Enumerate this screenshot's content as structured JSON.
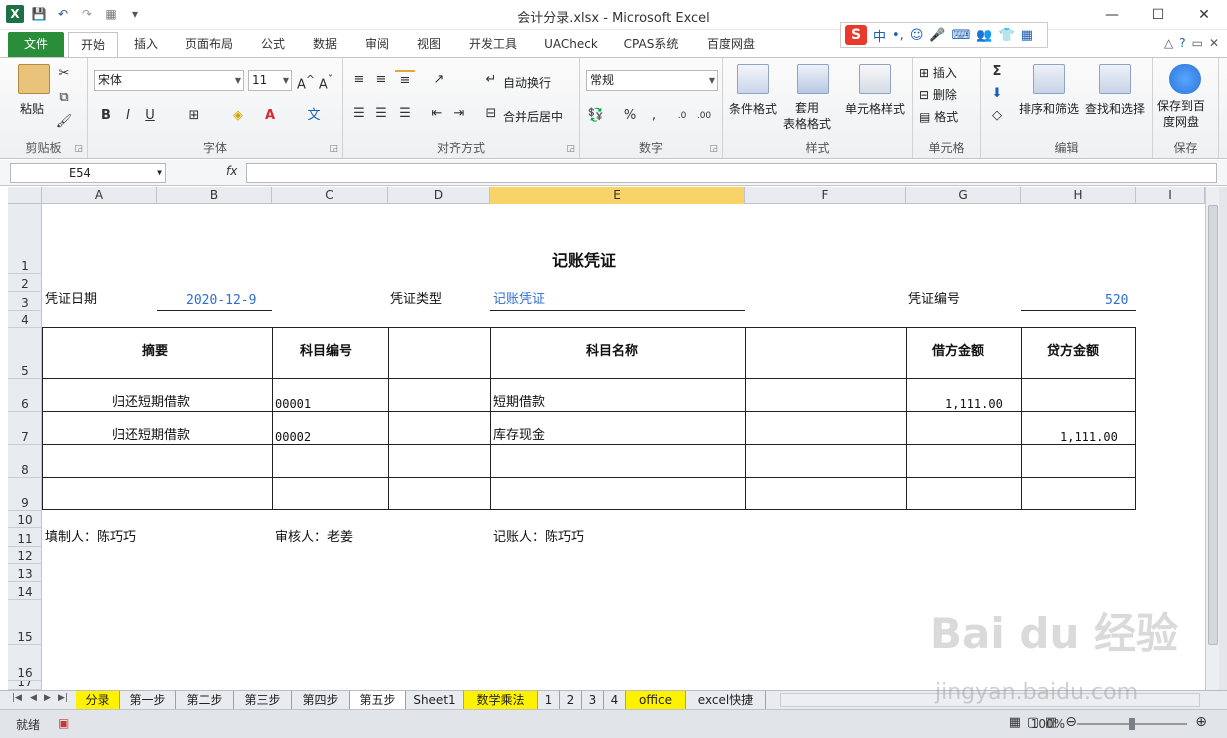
{
  "window": {
    "title": "会计分录.xlsx - Microsoft Excel",
    "minimize": "—",
    "maximize": "☐",
    "close": "✕"
  },
  "ime": {
    "logo": "S",
    "lang": "中",
    "punct": "•,"
  },
  "ribbon_tabs": [
    "文件",
    "开始",
    "插入",
    "页面布局",
    "公式",
    "数据",
    "审阅",
    "视图",
    "开发工具",
    "UACheck",
    "CPAS系统",
    "百度网盘"
  ],
  "ribbon": {
    "clipboard": {
      "label": "剪贴板",
      "paste": "粘贴"
    },
    "font": {
      "label": "字体",
      "name": "宋体",
      "size": "11",
      "bold": "B",
      "italic": "I",
      "underline": "U"
    },
    "align": {
      "label": "对齐方式",
      "wrap": "自动换行",
      "merge": "合并后居中"
    },
    "number": {
      "label": "数字",
      "format": "常规",
      "percent": "%",
      "comma": ","
    },
    "styles": {
      "label": "样式",
      "conditional": "条件格式",
      "table": "套用\n表格格式",
      "cell": "单元格样式"
    },
    "cells": {
      "label": "单元格",
      "insert": "插入",
      "delete": "删除",
      "format": "格式"
    },
    "editing": {
      "label": "编辑",
      "sum": "Σ",
      "sort": "排序和筛选",
      "find": "查找和选择"
    },
    "save": {
      "label": "保存",
      "save_to": "保存到百\n度网盘"
    }
  },
  "formula_bar": {
    "name_box": "E54",
    "fx": "fx",
    "value": ""
  },
  "columns": [
    "A",
    "B",
    "C",
    "D",
    "E",
    "F",
    "G",
    "H",
    "I"
  ],
  "rows": [
    "1",
    "2",
    "3",
    "4",
    "5",
    "6",
    "7",
    "8",
    "9",
    "10",
    "11",
    "12",
    "13",
    "14",
    "15",
    "16",
    "17"
  ],
  "sheet": {
    "title": "记账凭证",
    "date_label": "凭证日期",
    "date_value": "2020-12-9",
    "type_label": "凭证类型",
    "type_value": "记账凭证",
    "no_label": "凭证编号",
    "no_value": "520",
    "headers": {
      "summary": "摘要",
      "code": "科目编号",
      "name": "科目名称",
      "debit": "借方金额",
      "credit": "贷方金额"
    },
    "entries": [
      {
        "summary": "归还短期借款",
        "code": "00001",
        "name": "短期借款",
        "debit": "1,111.00",
        "credit": ""
      },
      {
        "summary": "归还短期借款",
        "code": "00002",
        "name": "库存现金",
        "debit": "",
        "credit": "1,111.00"
      }
    ],
    "preparer": "填制人：陈巧巧",
    "reviewer": "审核人：老姜",
    "bookkeeper": "记账人：陈巧巧"
  },
  "sheet_tabs": [
    {
      "name": "分录",
      "yellow": true
    },
    {
      "name": "第一步",
      "yellow": false
    },
    {
      "name": "第二步",
      "yellow": false
    },
    {
      "name": "第三步",
      "yellow": false
    },
    {
      "name": "第四步",
      "yellow": false
    },
    {
      "name": "第五步",
      "yellow": false,
      "active": true
    },
    {
      "name": "Sheet1",
      "yellow": false
    },
    {
      "name": "数学乘法",
      "yellow": true
    },
    {
      "name": "1",
      "yellow": false
    },
    {
      "name": "2",
      "yellow": false
    },
    {
      "name": "3",
      "yellow": false
    },
    {
      "name": "4",
      "yellow": false
    },
    {
      "name": "office",
      "yellow": true
    },
    {
      "name": "excel快捷",
      "yellow": false
    }
  ],
  "status": {
    "ready": "就绪",
    "zoom": "100%"
  },
  "watermark": {
    "main": "Bai du 经验",
    "sub": "jingyan.baidu.com"
  }
}
